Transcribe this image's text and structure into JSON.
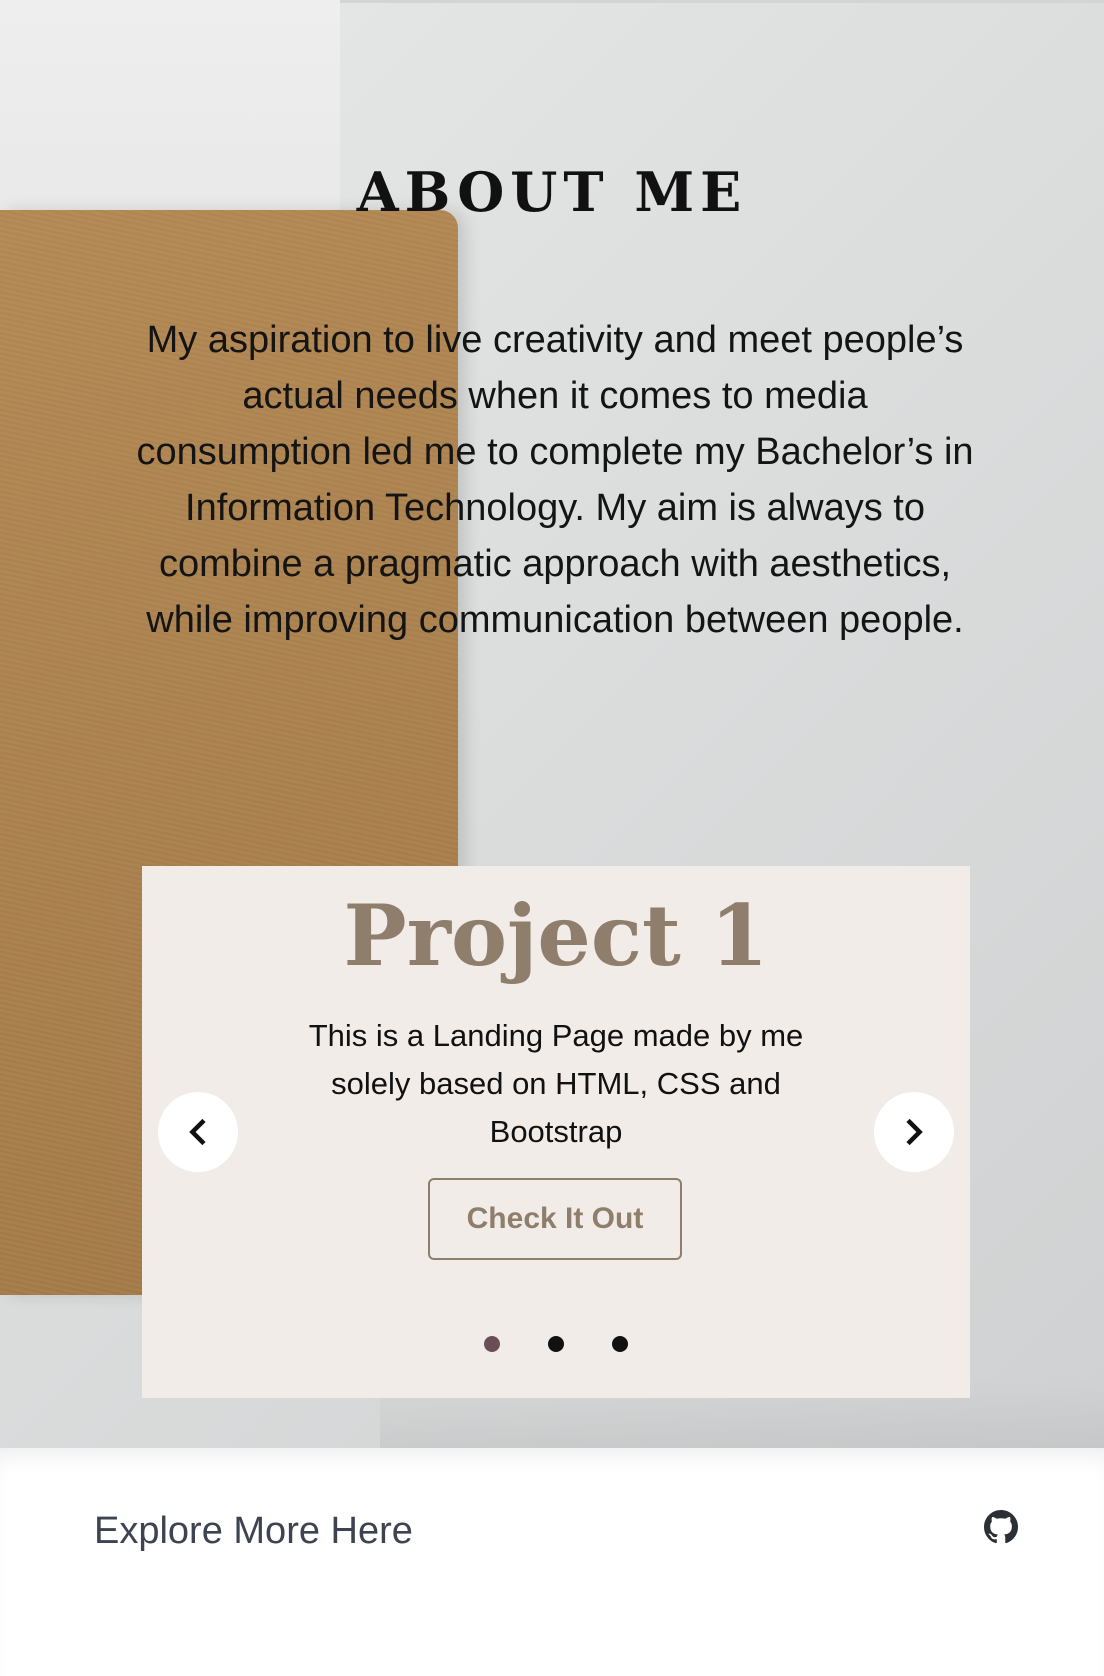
{
  "about": {
    "title": "ABOUT ME",
    "intro": "My aspiration to live creativity and meet people’s actual needs when it comes to media consumption led me to complete my Bachelor’s in Information Technology. My aim is always to combine a pragmatic approach with aesthetics, while improving communication between people."
  },
  "carousel": {
    "project_title": "Project 1",
    "project_description": "This is a Landing Page made by me solely based on HTML, CSS and Bootstrap",
    "cta_label": "Check It Out",
    "prev_icon": "chevron-left-icon",
    "next_icon": "chevron-right-icon",
    "active_slide": 1,
    "slide_count": 3
  },
  "footer": {
    "link_label": "Explore More Here",
    "icon": "github-icon"
  },
  "colors": {
    "accent": "#8f7e6b",
    "card_background": "#f2ece8",
    "active_dot": "#6b4c57",
    "text_dark": "#111111",
    "footer_text": "#3d4350"
  }
}
